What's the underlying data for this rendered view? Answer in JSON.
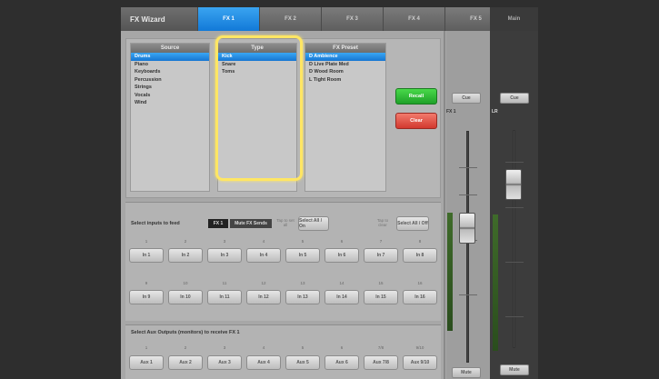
{
  "tabs": {
    "wizard": "FX Wizard",
    "fx": [
      "FX 1",
      "FX 2",
      "FX 3",
      "FX 4",
      "FX 5"
    ],
    "main": "Main"
  },
  "columns": {
    "source": {
      "header": "Source",
      "items": [
        "Drums",
        "Piano",
        "Keyboards",
        "Percussion",
        "Strings",
        "Vocals",
        "Wind"
      ]
    },
    "type": {
      "header": "Type",
      "items": [
        "Kick",
        "Snare",
        "Toms"
      ]
    },
    "preset": {
      "header": "FX Preset",
      "items": [
        "D Ambience",
        "D Live Plate Med",
        "D Wood Room",
        "L Tight Room"
      ]
    }
  },
  "buttons": {
    "recall": "Recall",
    "clear": "Clear"
  },
  "inputs_section": {
    "label": "Select inputs to feed",
    "chip_fx": "FX 1",
    "chip_mute": "Mute FX Sends",
    "note_left": "Tap to set all",
    "btn_all_on": "Select All / On",
    "note_right": "Tap to clear",
    "btn_all_off": "Select All / Off",
    "row1_nums": [
      "1",
      "2",
      "3",
      "4",
      "5",
      "6",
      "7",
      "8"
    ],
    "row1": [
      "In 1",
      "In 2",
      "In 3",
      "In 4",
      "In 5",
      "In 6",
      "In 7",
      "In 8"
    ],
    "row2_nums": [
      "9",
      "10",
      "11",
      "12",
      "13",
      "14",
      "15",
      "16"
    ],
    "row2": [
      "In 9",
      "In 10",
      "In 11",
      "In 12",
      "In 13",
      "In 14",
      "In 15",
      "In 16"
    ]
  },
  "aux_section": {
    "label": "Select Aux Outputs (monitors) to receive FX 1",
    "nums": [
      "1",
      "2",
      "3",
      "4",
      "5",
      "6",
      "7/8",
      "9/10"
    ],
    "buttons": [
      "Aux 1",
      "Aux 2",
      "Aux 3",
      "Aux 4",
      "Aux 5",
      "Aux 6",
      "Aux 7/8",
      "Aux 9/10"
    ]
  },
  "fx_strip": {
    "top_button": "Cue",
    "label": "FX 1",
    "bottom_button": "Mute"
  },
  "main_strip": {
    "top_button": "Cue",
    "label": "LR",
    "bottom_button": "Mute"
  },
  "colors": {
    "accent": "#1a86e0",
    "recall": "#2fb833",
    "clear": "#e14f42",
    "highlight": "#ffe663"
  }
}
